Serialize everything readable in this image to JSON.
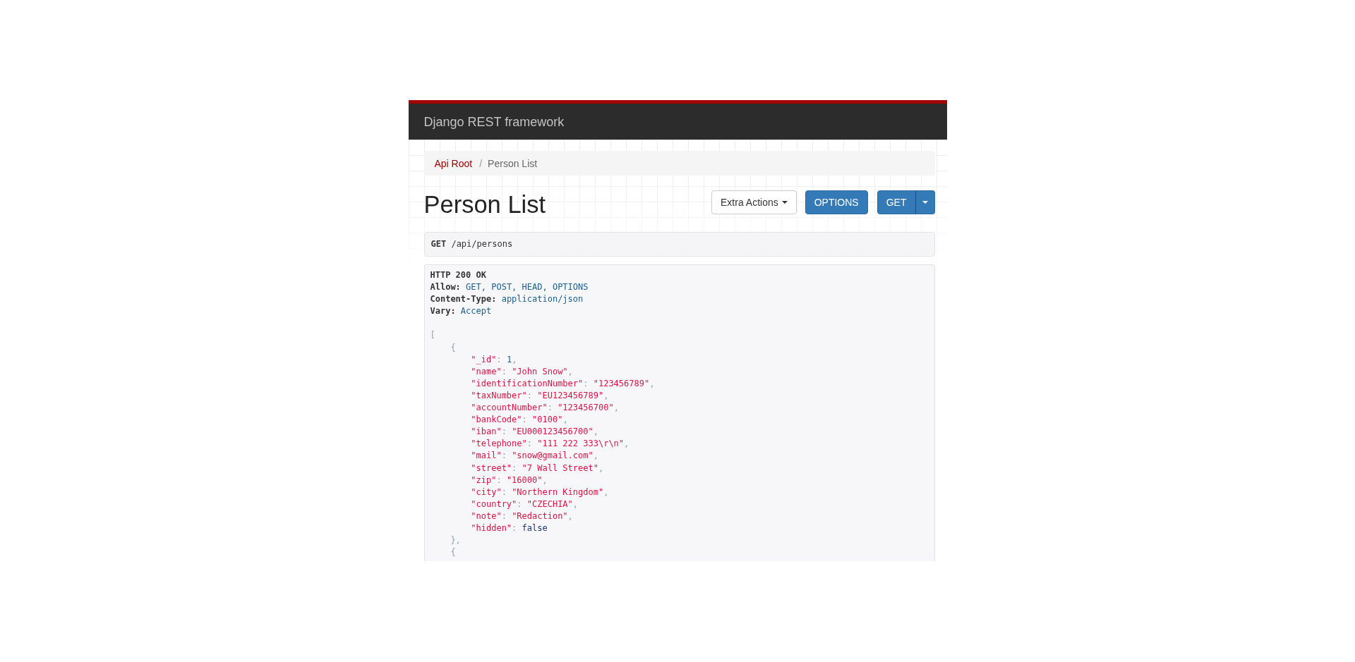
{
  "navbar": {
    "brand": "Django REST framework"
  },
  "breadcrumb": {
    "separator": "/",
    "items": [
      {
        "label": "Api Root",
        "selected": false
      },
      {
        "label": "Person List",
        "selected": true
      }
    ]
  },
  "page_title": "Person List",
  "actions": [
    {
      "kind": "dropdown",
      "label": "Extra Actions"
    },
    {
      "kind": "button",
      "label": "OPTIONS"
    },
    {
      "kind": "split",
      "label": "GET"
    }
  ],
  "request": {
    "method": "GET",
    "path": "/api/persons"
  },
  "response": {
    "status": "HTTP 200 OK",
    "headers": [
      {
        "name": "Allow:",
        "value": "GET, POST, HEAD, OPTIONS"
      },
      {
        "name": "Content-Type:",
        "value": "application/json"
      },
      {
        "name": "Vary:",
        "value": "Accept"
      }
    ],
    "body": {
      "open": "[",
      "items": [
        {
          "open": "{",
          "fields": [
            {
              "key": "\"_id\"",
              "colon": ":",
              "value": "1",
              "kind": "number",
              "end": ","
            },
            {
              "key": "\"name\"",
              "colon": ":",
              "value": "\"John Snow\"",
              "kind": "string",
              "end": ","
            },
            {
              "key": "\"identificationNumber\"",
              "colon": ":",
              "value": "\"123456789\"",
              "kind": "string",
              "end": ","
            },
            {
              "key": "\"taxNumber\"",
              "colon": ":",
              "value": "\"EU123456789\"",
              "kind": "string",
              "end": ","
            },
            {
              "key": "\"accountNumber\"",
              "colon": ":",
              "value": "\"123456700\"",
              "kind": "string",
              "end": ","
            },
            {
              "key": "\"bankCode\"",
              "colon": ":",
              "value": "\"0100\"",
              "kind": "string",
              "end": ","
            },
            {
              "key": "\"iban\"",
              "colon": ":",
              "value": "\"EU000123456700\"",
              "kind": "string",
              "end": ","
            },
            {
              "key": "\"telephone\"",
              "colon": ":",
              "value": "\"111 222 333\\r\\n\"",
              "kind": "string",
              "end": ","
            },
            {
              "key": "\"mail\"",
              "colon": ":",
              "value": "\"snow@gmail.com\"",
              "kind": "string",
              "end": ","
            },
            {
              "key": "\"street\"",
              "colon": ":",
              "value": "\"7 Wall Street\"",
              "kind": "string",
              "end": ","
            },
            {
              "key": "\"zip\"",
              "colon": ":",
              "value": "\"16000\"",
              "kind": "string",
              "end": ","
            },
            {
              "key": "\"city\"",
              "colon": ":",
              "value": "\"Northern Kingdom\"",
              "kind": "string",
              "end": ","
            },
            {
              "key": "\"country\"",
              "colon": ":",
              "value": "\"CZECHIA\"",
              "kind": "string",
              "end": ","
            },
            {
              "key": "\"note\"",
              "colon": ":",
              "value": "\"Redaction\"",
              "kind": "string",
              "end": ","
            },
            {
              "key": "\"hidden\"",
              "colon": ":",
              "value": "false",
              "kind": "literal"
            }
          ],
          "close": "},"
        },
        {
          "open": "{"
        }
      ]
    }
  }
}
